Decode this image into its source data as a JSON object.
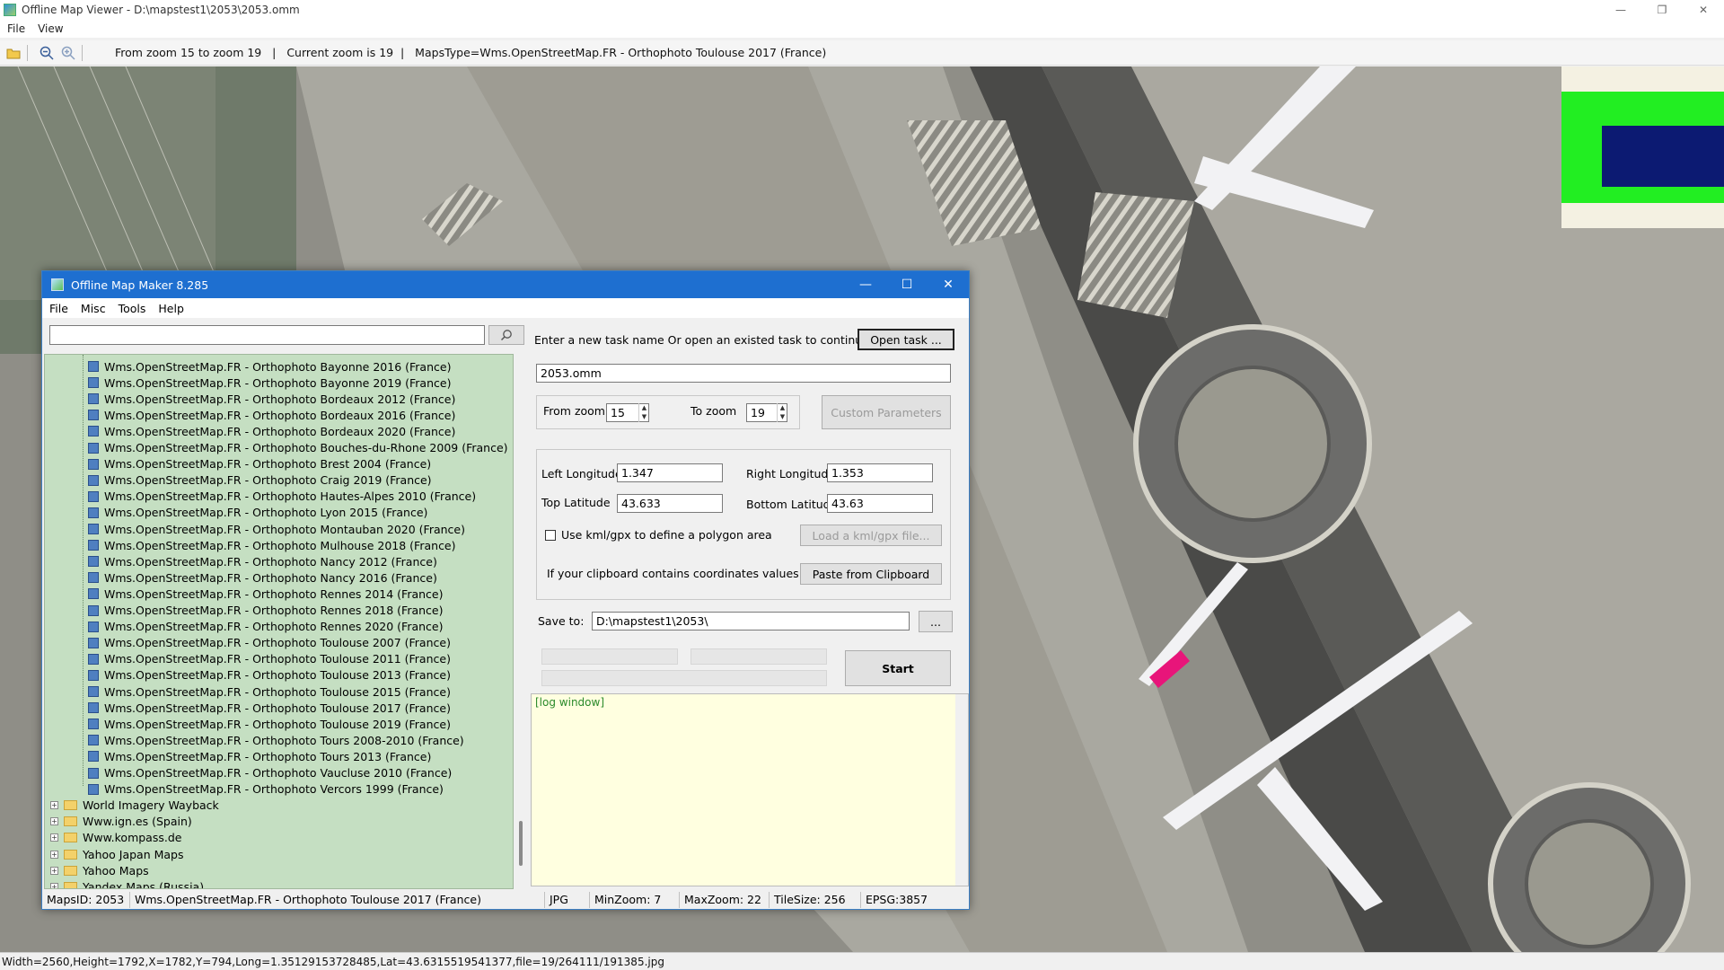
{
  "window": {
    "title": "Offline Map Viewer - D:\\mapstest1\\2053\\2053.omm",
    "minimize": "—",
    "maximize": "❐",
    "close": "✕"
  },
  "menu": [
    "File",
    "View"
  ],
  "toolbar": {
    "info": "From zoom 15 to zoom 19   |   Current zoom is 19  |   MapsType=Wms.OpenStreetMap.FR - Orthophoto Toulouse 2017 (France)"
  },
  "status": "Width=2560,Height=1792,X=1782,Y=794,Long=1.35129153728485,Lat=43.6315519541377,file=19/264111/191385.jpg",
  "dialog": {
    "title": "Offline Map Maker 8.285",
    "menu": [
      "File",
      "Misc",
      "Tools",
      "Help"
    ],
    "search": {
      "value": "",
      "placeholder": ""
    },
    "tree_leaves": [
      "Wms.OpenStreetMap.FR - Orthophoto Bayonne 2016 (France)",
      "Wms.OpenStreetMap.FR - Orthophoto Bayonne 2019 (France)",
      "Wms.OpenStreetMap.FR - Orthophoto Bordeaux 2012 (France)",
      "Wms.OpenStreetMap.FR - Orthophoto Bordeaux 2016 (France)",
      "Wms.OpenStreetMap.FR - Orthophoto Bordeaux 2020 (France)",
      "Wms.OpenStreetMap.FR - Orthophoto Bouches-du-Rhone 2009 (France)",
      "Wms.OpenStreetMap.FR - Orthophoto Brest 2004 (France)",
      "Wms.OpenStreetMap.FR - Orthophoto Craig 2019 (France)",
      "Wms.OpenStreetMap.FR - Orthophoto Hautes-Alpes 2010 (France)",
      "Wms.OpenStreetMap.FR - Orthophoto Lyon 2015 (France)",
      "Wms.OpenStreetMap.FR - Orthophoto Montauban 2020 (France)",
      "Wms.OpenStreetMap.FR - Orthophoto Mulhouse 2018 (France)",
      "Wms.OpenStreetMap.FR - Orthophoto Nancy 2012 (France)",
      "Wms.OpenStreetMap.FR - Orthophoto Nancy 2016 (France)",
      "Wms.OpenStreetMap.FR - Orthophoto Rennes 2014 (France)",
      "Wms.OpenStreetMap.FR - Orthophoto Rennes 2018 (France)",
      "Wms.OpenStreetMap.FR - Orthophoto Rennes 2020 (France)",
      "Wms.OpenStreetMap.FR - Orthophoto Toulouse 2007 (France)",
      "Wms.OpenStreetMap.FR - Orthophoto Toulouse 2011 (France)",
      "Wms.OpenStreetMap.FR - Orthophoto Toulouse 2013 (France)",
      "Wms.OpenStreetMap.FR - Orthophoto Toulouse 2015 (France)",
      "Wms.OpenStreetMap.FR - Orthophoto Toulouse 2017 (France)",
      "Wms.OpenStreetMap.FR - Orthophoto Toulouse 2019 (France)",
      "Wms.OpenStreetMap.FR - Orthophoto Tours 2008-2010 (France)",
      "Wms.OpenStreetMap.FR - Orthophoto Tours 2013 (France)",
      "Wms.OpenStreetMap.FR - Orthophoto Vaucluse 2010 (France)",
      "Wms.OpenStreetMap.FR - Orthophoto Vercors 1999 (France)"
    ],
    "tree_folders": [
      "World Imagery Wayback",
      "Www.ign.es (Spain)",
      "Www.kompass.de",
      "Yahoo Japan Maps",
      "Yahoo Maps",
      "Yandex Maps (Russia)"
    ],
    "task_prompt": "Enter a new task name Or open an existed task to continue:",
    "open_task": "Open task ...",
    "task_name": "2053.omm",
    "from_zoom_label": "From zoom",
    "from_zoom": "15",
    "to_zoom_label": "To zoom",
    "to_zoom": "19",
    "custom_params": "Custom Parameters",
    "left_lon_label": "Left Longitude",
    "left_lon": "1.347",
    "right_lon_label": "Right Longitude",
    "right_lon": "1.353",
    "top_lat_label": "Top Latitude",
    "top_lat": "43.633",
    "bottom_lat_label": "Bottom Latitude",
    "bottom_lat": "43.63",
    "kml_label": "Use kml/gpx to define a polygon area",
    "kml_button": "Load a kml/gpx file...",
    "clipboard_label": "If your clipboard contains coordinates values:",
    "clipboard_button": "Paste from Clipboard",
    "save_label": "Save to:",
    "save_path": "D:\\mapstest1\\2053\\",
    "browse": "...",
    "start": "Start",
    "log": "[log window]",
    "status": {
      "mapsid": "MapsID: 2053",
      "maptype": "Wms.OpenStreetMap.FR - Orthophoto Toulouse 2017 (France)",
      "format": "JPG",
      "minzoom": "MinZoom: 7",
      "maxzoom": "MaxZoom: 22",
      "tilesize": "TileSize: 256",
      "epsg": "EPSG:3857"
    }
  },
  "colors": {
    "dialog_titlebar": "#1e6fd0",
    "tree_background": "#c5dfc2",
    "log_background": "#ffffe0",
    "minimap_green": "#22ee22",
    "minimap_blue": "#0c1a72"
  }
}
